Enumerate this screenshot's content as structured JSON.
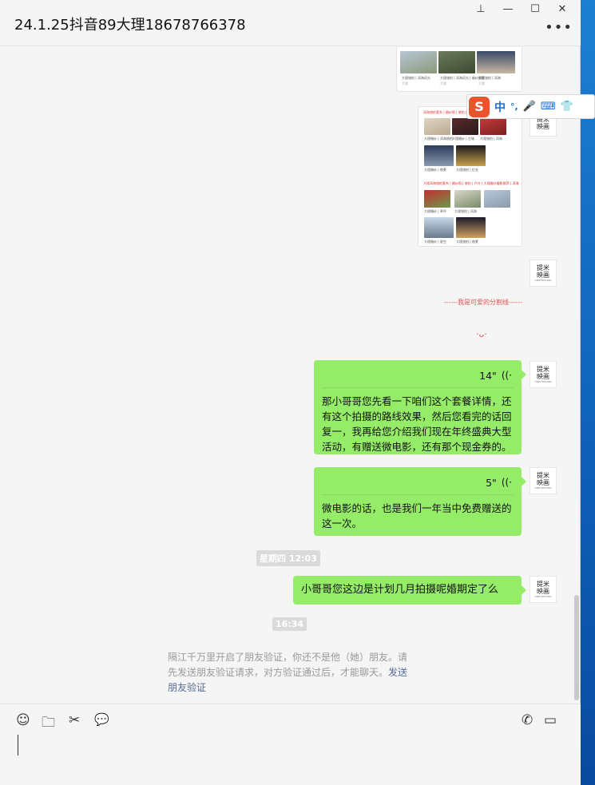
{
  "window": {
    "title": "24.1.25抖音89大理18678766378",
    "controls": {
      "pin": "⊥",
      "minimize": "—",
      "maximize": "☐",
      "close": "✕"
    },
    "more": "•••"
  },
  "ime": {
    "logo": "S",
    "mode": "中",
    "punct": "°,",
    "voice": "🎤",
    "keyboard": "⌨",
    "skin": "👕"
  },
  "card1": {
    "captions": [
      "大理旅拍 | 洱海风光",
      "大理旅拍 | 洱海风光 | 婚纱摄影",
      "大理旅拍 | 洱海"
    ],
    "meta": [
      "大理",
      "大理",
      "大理"
    ]
  },
  "card2": {
    "headline1": "洱海旅拍套系 | 婚纱照 | 旅拍 | 户外 | 大理洱海旅拍 | 大理婚纱摄影推荐",
    "headline2": "大理洱海旅拍套系 | 婚纱照 | 旅拍 | 户外 | 大理婚纱摄影推荐 | 洱海旅拍",
    "captions": [
      "大理婚纱 | 洱海旅拍",
      "大理婚纱 | 古城",
      "大理旅拍 | 洱海",
      "大理婚纱 | 夜景",
      "大理旅拍 | 红衣",
      "大理婚纱 | 草坪",
      "大理旅拍 | 洱海",
      "大理婚纱 | 星空",
      "大理旅拍 | 夜景"
    ]
  },
  "avatar": {
    "line1": "提米",
    "line2": "映画",
    "sub": "TIMI STUDIO"
  },
  "divider": {
    "symbol": "·ᴗ·",
    "text": "------我是可爱的分割线------"
  },
  "messages": [
    {
      "duration": "14\"",
      "voice_icon": "((·",
      "text": "那小哥哥您先看一下咱们这个套餐详情，还有这个拍摄的路线效果，然后您看完的话回复一，我再给您介绍我们现在年终盛典大型活动，有赠送微电影，还有那个现金券的。"
    },
    {
      "duration": "5\"",
      "voice_icon": "((·",
      "text": "微电影的话，也是我们一年当中免费赠送的这一次。"
    },
    {
      "text": "小哥哥您这边是计划几月拍摄呢婚期定了么"
    }
  ],
  "timestamps": [
    "星期四 12:03",
    "16:34"
  ],
  "system_note": {
    "text": "隔江千万里开启了朋友验证，你还不是他（她）朋友。请先发送朋友验证请求，对方验证通过后，才能聊天。",
    "link": "发送朋友验证"
  },
  "toolbar": {
    "emoji": "☺",
    "folder": "🗀",
    "scissors": "✂",
    "chat": "💬",
    "phone": "✆",
    "video": "▭"
  },
  "colors": {
    "bubble": "#95ec69",
    "background": "#f5f5f5",
    "link": "#576b95",
    "accent_red": "#e65050"
  }
}
